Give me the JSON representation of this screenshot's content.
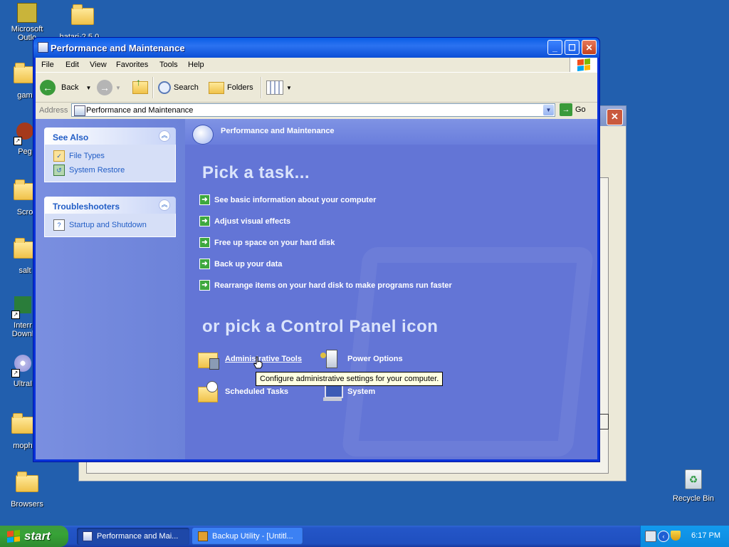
{
  "desktop": {
    "icons": [
      {
        "label": "Microsoft\nOutlo"
      },
      {
        "label": "hatari-2.5.0..."
      },
      {
        "label": "gam"
      },
      {
        "label": "Peg"
      },
      {
        "label": "Scro"
      },
      {
        "label": "salt"
      },
      {
        "label": "Interr\nDownl"
      },
      {
        "label": "UltraI"
      },
      {
        "label": "moph"
      },
      {
        "label": "Browsers"
      },
      {
        "label": "Recycle Bin"
      }
    ]
  },
  "window": {
    "title": "Performance and Maintenance",
    "menu": [
      "File",
      "Edit",
      "View",
      "Favorites",
      "Tools",
      "Help"
    ],
    "toolbar": {
      "back": "Back",
      "search": "Search",
      "folders": "Folders"
    },
    "address": {
      "label": "Address",
      "value": "Performance and Maintenance",
      "go": "Go"
    },
    "see_also": {
      "header": "See Also",
      "items": [
        "File Types",
        "System Restore"
      ]
    },
    "troubleshooters": {
      "header": "Troubleshooters",
      "items": [
        "Startup and Shutdown"
      ]
    },
    "main": {
      "header": "Performance and Maintenance",
      "pick_task": "Pick a task...",
      "tasks": [
        "See basic information about your computer",
        "Adjust visual effects",
        "Free up space on your hard disk",
        "Back up your data",
        "Rearrange items on your hard disk to make programs run faster"
      ],
      "pick_icon": "or pick a Control Panel icon",
      "icons": [
        "Administrative Tools",
        "Power Options",
        "Scheduled Tasks",
        "System"
      ],
      "tooltip": "Configure administrative settings for your computer."
    }
  },
  "taskbar": {
    "start": "start",
    "buttons": [
      "Performance and Mai...",
      "Backup Utility - [Untitl..."
    ],
    "clock": "6:17 PM"
  },
  "colors": {
    "desktop": "#225fae",
    "titlebar": "#0a5ee6",
    "content_bg": "#6375d6",
    "start_green": "#37a337"
  }
}
